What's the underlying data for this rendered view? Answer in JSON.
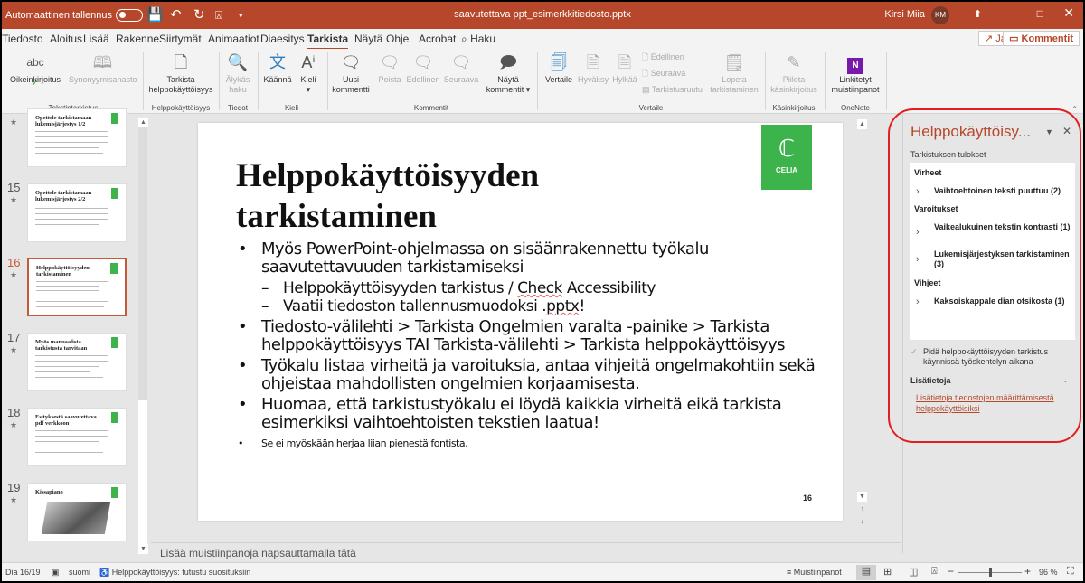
{
  "titlebar": {
    "autosave_label": "Automaattinen tallennus",
    "document_title": "saavutettava ppt_esimerkkitiedosto.pptx",
    "user_name": "Kirsi Miia",
    "user_initials": "KM"
  },
  "tabs": [
    {
      "label": "Tiedosto"
    },
    {
      "label": "Aloitus"
    },
    {
      "label": "Lisää"
    },
    {
      "label": "Rakenne"
    },
    {
      "label": "Siirtymät"
    },
    {
      "label": "Animaatiot"
    },
    {
      "label": "Diaesitys"
    },
    {
      "label": "Tarkista",
      "active": true
    },
    {
      "label": "Näytä"
    },
    {
      "label": "Ohje"
    },
    {
      "label": "Acrobat"
    },
    {
      "label": "Haku"
    }
  ],
  "share_label": "Jaa",
  "comments_label": "Kommentit",
  "ribbon": {
    "buttons": {
      "spelling": "Oikeinkirjoitus",
      "thesaurus": "Synonyymisanasto",
      "check_accessibility_1": "Tarkista",
      "check_accessibility_2": "helppokäyttöisyys",
      "smart_lookup_1": "Älykäs",
      "smart_lookup_2": "haku",
      "translate": "Käännä",
      "language": "Kieli",
      "new_comment_1": "Uusi",
      "new_comment_2": "kommentti",
      "delete": "Poista",
      "previous": "Edellinen",
      "next": "Seuraava",
      "show_comments_1": "Näytä",
      "show_comments_2": "kommentit",
      "compare": "Vertaile",
      "accept": "Hyväksy",
      "reject": "Hylkää",
      "rev_previous": "Edellinen",
      "rev_next": "Seuraava",
      "reviewing_pane": "Tarkistusruutu",
      "end_review_1": "Lopeta",
      "end_review_2": "tarkistaminen",
      "hide_ink_1": "Piilota",
      "hide_ink_2": "käsinkirjoitus",
      "linked_notes_1": "Linkitetyt",
      "linked_notes_2": "muistiinpanot"
    },
    "groups": {
      "proofing": "Tekstintarkistus",
      "accessibility": "Helppokäyttöisyys",
      "insights": "Tiedot",
      "language": "Kieli",
      "comments": "Kommentit",
      "compare": "Vertaile",
      "ink": "Käsinkirjoitus",
      "onenote": "OneNote"
    }
  },
  "thumbnails": [
    {
      "number": "",
      "title": "Opettele tarkistamaan lukemisjärjestys 1/2"
    },
    {
      "number": "15",
      "title": "Opettele tarkistamaan lukemisjärjestys 2/2"
    },
    {
      "number": "16",
      "title": "Helppokäyttöisyyden tarkistaminen",
      "active": true
    },
    {
      "number": "17",
      "title": "Myös manuaalista tarkistusta tarvitaan"
    },
    {
      "number": "18",
      "title": "Esityksestä saavutettava pdf verkkoon"
    },
    {
      "number": "19",
      "title": "Kissapiano"
    }
  ],
  "slide": {
    "title": "Helppokäyttöisyyden tarkistaminen",
    "logo_text": "CELIA",
    "bullets": {
      "b1": "Myös PowerPoint-ohjelmassa on sisäänrakennettu työkalu saavutettavuuden tarkistamiseksi",
      "b1_1_pre": "Helppokäyttöisyyden tarkistus / ",
      "b1_1_squig": "Check",
      "b1_1_post": " Accessibility",
      "b1_2_pre": "Vaatii tiedoston tallennusmuodoksi .",
      "b1_2_squig": "pptx",
      "b1_2_post": "!",
      "b2": "Tiedosto-välilehti > Tarkista Ongelmien varalta -painike > Tarkista helppokäyttöisyys TAI Tarkista-välilehti > Tarkista helppokäyttöisyys",
      "b3": "Työkalu listaa virheitä ja varoituksia, antaa vihjeitä ongelmakohtiin sekä ohjeistaa mahdollisten ongelmien korjaamisesta.",
      "b4": "Huomaa, että tarkistustyökalu ei löydä kaikkia virheitä eikä tarkista esimerkiksi vaihtoehtoisten tekstien laatua!",
      "b5": "Se ei myöskään herjaa liian pienestä fontista."
    },
    "slide_number": "16"
  },
  "notes_placeholder": "Lisää muistiinpanoja napsauttamalla tätä",
  "pane": {
    "title": "Helppokäyttöisy...",
    "subtitle": "Tarkistuksen tulokset",
    "categories": {
      "errors": "Virheet",
      "warnings": "Varoitukset",
      "tips": "Vihjeet"
    },
    "results": {
      "alt_text": "Vaihtoehtoinen teksti puuttuu (2)",
      "contrast": "Vaikealukuinen tekstin kontrasti (1)",
      "reading_order": "Lukemisjärjestyksen tarkistaminen (3)",
      "duplicate_title": "Kaksoiskappale dian otsikosta (1)"
    },
    "keep_running_label": "Pidä helppokäyttöisyyden tarkistus käynnissä työskentelyn aikana",
    "keep_running_checked": true,
    "more_info_label": "Lisätietoja",
    "more_info_link": "Lisätietoja tiedostojen määrittämisestä helppokäyttöisiksi"
  },
  "statusbar": {
    "slide_indicator": "Dia 16/19",
    "language": "suomi",
    "accessibility": "Helppokäyttöisyys: tutustu suosituksiin",
    "notes_button": "Muistiinpanot",
    "zoom_level": "96 %"
  }
}
